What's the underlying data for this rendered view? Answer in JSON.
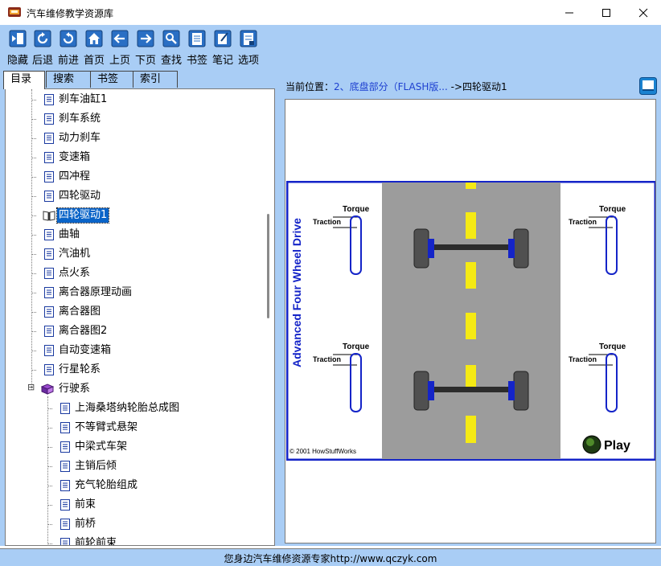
{
  "window": {
    "title": "汽车维修教学资源库",
    "minimize_label": "—",
    "maximize_label": "☐",
    "close_label": "✕"
  },
  "toolbar": {
    "buttons": [
      {
        "label": "隐藏",
        "icon": "hide-icon"
      },
      {
        "label": "后退",
        "icon": "back-icon"
      },
      {
        "label": "前进",
        "icon": "forward-icon"
      },
      {
        "label": "首页",
        "icon": "home-icon"
      },
      {
        "label": "上页",
        "icon": "prev-page-icon"
      },
      {
        "label": "下页",
        "icon": "next-page-icon"
      },
      {
        "label": "查找",
        "icon": "search-icon"
      },
      {
        "label": "书签",
        "icon": "bookmark-icon"
      },
      {
        "label": "笔记",
        "icon": "note-icon"
      },
      {
        "label": "选项",
        "icon": "options-icon"
      }
    ]
  },
  "tabs": [
    {
      "label": "目录",
      "active": true
    },
    {
      "label": "搜索",
      "active": false
    },
    {
      "label": "书签",
      "active": false
    },
    {
      "label": "索引",
      "active": false
    }
  ],
  "tree": {
    "items": [
      {
        "label": "刹车油缸1",
        "level": 1,
        "kind": "page"
      },
      {
        "label": "刹车系统",
        "level": 1,
        "kind": "page"
      },
      {
        "label": "动力刹车",
        "level": 1,
        "kind": "page"
      },
      {
        "label": "变速箱",
        "level": 1,
        "kind": "page"
      },
      {
        "label": "四冲程",
        "level": 1,
        "kind": "page"
      },
      {
        "label": "四轮驱动",
        "level": 1,
        "kind": "page"
      },
      {
        "label": "四轮驱动1",
        "level": 1,
        "kind": "open-page",
        "selected": true
      },
      {
        "label": "曲轴",
        "level": 1,
        "kind": "page"
      },
      {
        "label": "汽油机",
        "level": 1,
        "kind": "page"
      },
      {
        "label": "点火系",
        "level": 1,
        "kind": "page"
      },
      {
        "label": "离合器原理动画",
        "level": 1,
        "kind": "page"
      },
      {
        "label": "离合器图",
        "level": 1,
        "kind": "page"
      },
      {
        "label": "离合器图2",
        "level": 1,
        "kind": "page"
      },
      {
        "label": "自动变速箱",
        "level": 1,
        "kind": "page"
      },
      {
        "label": "行星轮系",
        "level": 1,
        "kind": "page"
      },
      {
        "label": "行驶系",
        "level": 0,
        "kind": "book",
        "expand": "⊟"
      },
      {
        "label": "上海桑塔纳轮胎总成图",
        "level": 2,
        "kind": "page"
      },
      {
        "label": "不等臂式悬架",
        "level": 2,
        "kind": "page"
      },
      {
        "label": "中梁式车架",
        "level": 2,
        "kind": "page"
      },
      {
        "label": "主销后倾",
        "level": 2,
        "kind": "page"
      },
      {
        "label": "充气轮胎组成",
        "level": 2,
        "kind": "page"
      },
      {
        "label": "前束",
        "level": 2,
        "kind": "page"
      },
      {
        "label": "前桥",
        "level": 2,
        "kind": "page"
      },
      {
        "label": "前轮前束",
        "level": 2,
        "kind": "page"
      }
    ]
  },
  "breadcrumb": {
    "prefix": "当前位置：",
    "path": "2、底盘部分（FLASH版...",
    "arrow": " ->",
    "current": "四轮驱动1"
  },
  "flash": {
    "title": "Advanced Four Wheel Drive",
    "torque_label": "Torque",
    "traction_label": "Traction",
    "copyright": "© 2001 HowStuffWorks",
    "play_label": "Play",
    "colors": {
      "border": "#1424c8",
      "road": "#9c9c9c",
      "stripe": "#f5ea14",
      "gauge": "#1424c8",
      "tire": "#505050",
      "hub": "#1424c8"
    }
  },
  "status": {
    "text": "您身边汽车维修资源专家http://www.qczyk.com"
  }
}
